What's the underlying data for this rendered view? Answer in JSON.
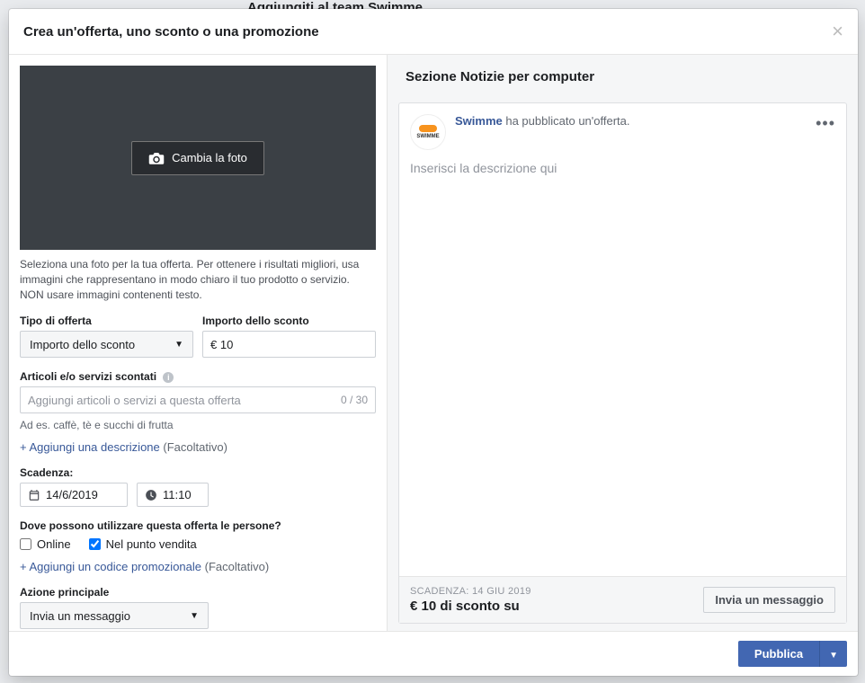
{
  "backdrop_title": "Aggiungiti al team Swimme",
  "modal": {
    "title": "Crea un'offerta, uno sconto o una promozione"
  },
  "photo": {
    "change_label": "Cambia la foto",
    "help": "Seleziona una foto per la tua offerta. Per ottenere i risultati migliori, usa immagini che rappresentano in modo chiaro il tuo prodotto o servizio. NON usare immagini contenenti testo."
  },
  "offer_type": {
    "label": "Tipo di offerta",
    "value": "Importo dello sconto"
  },
  "discount_amount": {
    "label": "Importo dello sconto",
    "value": "€ 10"
  },
  "items": {
    "label": "Articoli e/o servizi scontati",
    "placeholder": "Aggiungi articoli o servizi a questa offerta",
    "count": "0 / 30",
    "hint": "Ad es. caffè, tè e succhi di frutta"
  },
  "add_desc": {
    "link": "+ Aggiungi una descrizione",
    "optional": "(Facoltativo)"
  },
  "expiry": {
    "label": "Scadenza:",
    "date": "14/6/2019",
    "time": "11:10"
  },
  "where": {
    "label": "Dove possono utilizzare questa offerta le persone?",
    "online": "Online",
    "instore": "Nel punto vendita"
  },
  "promo_code": {
    "link": "+ Aggiungi un codice promozionale",
    "optional": "(Facoltativo)"
  },
  "main_action": {
    "label": "Azione principale",
    "value": "Invia un messaggio"
  },
  "preview": {
    "header": "Sezione Notizie per computer",
    "page_name": "Swimme",
    "headline_suffix": " ha pubblicato un'offerta.",
    "desc_placeholder": "Inserisci la descrizione qui",
    "deadline_label": "SCADENZA: 14 GIU 2019",
    "discount_text": "€ 10 di sconto su",
    "cta": "Invia un messaggio"
  },
  "footer": {
    "publish": "Pubblica"
  }
}
